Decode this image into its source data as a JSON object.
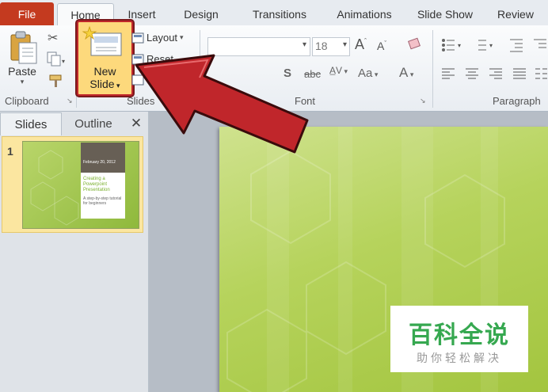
{
  "tabs": {
    "file": "File",
    "home": "Home",
    "insert": "Insert",
    "design": "Design",
    "transitions": "Transitions",
    "animations": "Animations",
    "slide_show": "Slide Show",
    "review": "Review"
  },
  "ribbon": {
    "clipboard": {
      "paste_label": "Paste",
      "group_label": "Clipboard"
    },
    "slides": {
      "new_slide_line1": "New",
      "new_slide_line2": "Slide",
      "layout_label": "Layout",
      "reset_label": "Reset",
      "group_label": "Slides"
    },
    "font": {
      "font_size": "18",
      "group_label": "Font"
    },
    "paragraph": {
      "group_label": "Paragraph"
    }
  },
  "left_panel": {
    "tab_slides": "Slides",
    "tab_outline": "Outline",
    "close_glyph": "✕",
    "slides": [
      {
        "number": "1",
        "thumb_date": "February 20, 2012",
        "thumb_title": "Creating a Powerpoint Presentation",
        "thumb_sub": "A step-by-step tutorial for beginners"
      }
    ]
  },
  "watermark": {
    "main": "百科全说",
    "sub": "助你轻松解决"
  },
  "colors": {
    "file_tab": "#c43a1f",
    "highlight": "#fdd97c",
    "arrow": "#c0262b",
    "slide_green": "#a3c53f",
    "watermark_green": "#36a850"
  }
}
